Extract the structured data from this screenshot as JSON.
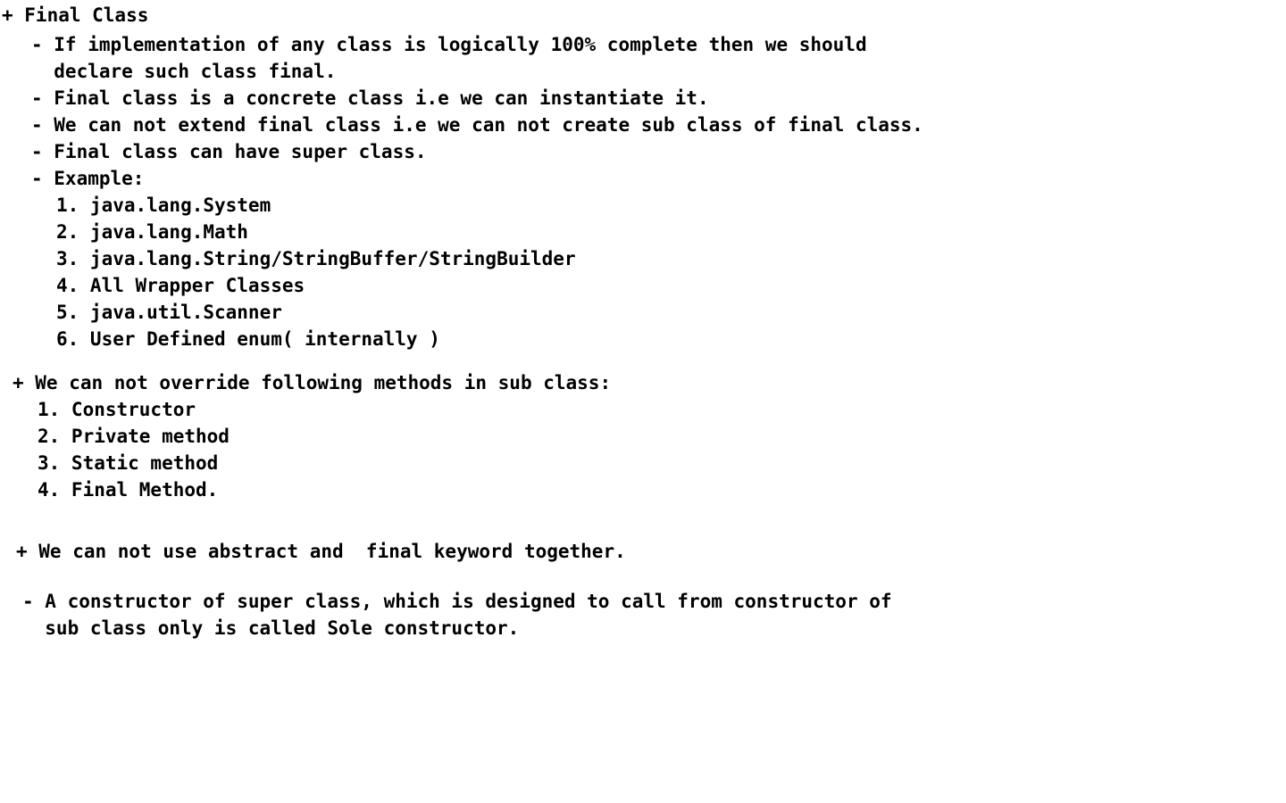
{
  "final_class": {
    "heading": "+ Final Class",
    "points": [
      "- If implementation of any class is logically 100% complete then we should",
      "  declare such class final.",
      "- Final class is a concrete class i.e we can instantiate it.",
      "- We can not extend final class i.e we can not create sub class of final class.",
      "- Final class can have super class.",
      "- Example:"
    ],
    "examples": [
      "1. java.lang.System",
      "2. java.lang.Math",
      "3. java.lang.String/StringBuffer/StringBuilder",
      "4. All Wrapper Classes",
      "5. java.util.Scanner",
      "6. User Defined enum( internally )"
    ]
  },
  "override": {
    "heading": "+ We can not override following methods in sub class:",
    "items": [
      "1. Constructor",
      "2. Private method",
      "3. Static method",
      "4. Final Method."
    ]
  },
  "abstract_final": {
    "note": "+ We can not use abstract and  final keyword together."
  },
  "sole_constructor": {
    "lines": [
      "- A constructor of super class, which is designed to call from constructor of",
      "  sub class only is called Sole constructor."
    ]
  }
}
